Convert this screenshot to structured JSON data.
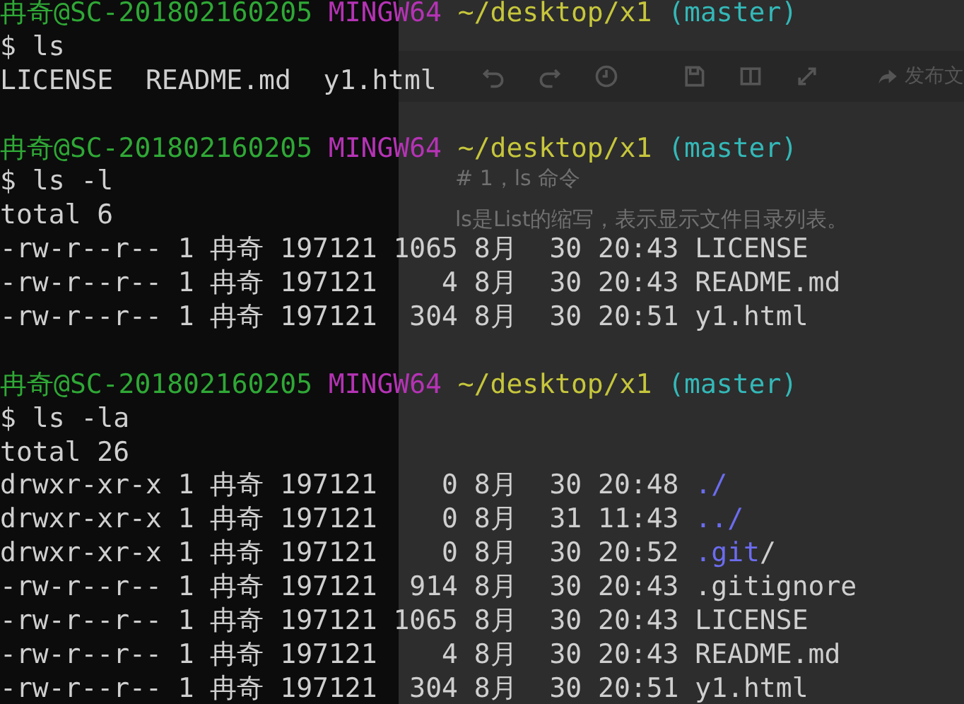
{
  "editor": {
    "toolbar": {
      "publish_label": "发布文"
    },
    "heading": "# 1，ls 命令",
    "paragraph": "ls是List的缩写，表示显示文件目录列表。"
  },
  "terminal": {
    "lines": [
      {
        "kind": "prompt",
        "segments": [
          {
            "kind": "user",
            "text": "冉奇@SC-201802160205"
          },
          {
            "kind": "env",
            "text": "MINGW64"
          },
          {
            "kind": "path",
            "text": "~/desktop/x1"
          },
          {
            "kind": "branch",
            "text": "(master)"
          }
        ]
      },
      {
        "kind": "command",
        "segments": [
          {
            "kind": "plain",
            "text": "$ ls"
          }
        ]
      },
      {
        "kind": "output",
        "segments": [
          {
            "kind": "plain",
            "text": "LICENSE  README.md  y1.html"
          }
        ]
      },
      {
        "kind": "blank"
      },
      {
        "kind": "prompt",
        "segments": [
          {
            "kind": "user",
            "text": "冉奇@SC-201802160205"
          },
          {
            "kind": "env",
            "text": "MINGW64"
          },
          {
            "kind": "path",
            "text": "~/desktop/x1"
          },
          {
            "kind": "branch",
            "text": "(master)"
          }
        ]
      },
      {
        "kind": "command",
        "segments": [
          {
            "kind": "plain",
            "text": "$ ls -l"
          }
        ]
      },
      {
        "kind": "output",
        "segments": [
          {
            "kind": "plain",
            "text": "total 6"
          }
        ]
      },
      {
        "kind": "output",
        "segments": [
          {
            "kind": "plain",
            "text": "-rw-r--r-- 1 冉奇 197121 1065 8月  30 20:43 LICENSE"
          }
        ]
      },
      {
        "kind": "output",
        "segments": [
          {
            "kind": "plain",
            "text": "-rw-r--r-- 1 冉奇 197121    4 8月  30 20:43 README.md"
          }
        ]
      },
      {
        "kind": "output",
        "segments": [
          {
            "kind": "plain",
            "text": "-rw-r--r-- 1 冉奇 197121  304 8月  30 20:51 y1.html"
          }
        ]
      },
      {
        "kind": "blank"
      },
      {
        "kind": "prompt",
        "segments": [
          {
            "kind": "user",
            "text": "冉奇@SC-201802160205"
          },
          {
            "kind": "env",
            "text": "MINGW64"
          },
          {
            "kind": "path",
            "text": "~/desktop/x1"
          },
          {
            "kind": "branch",
            "text": "(master)"
          }
        ]
      },
      {
        "kind": "command",
        "segments": [
          {
            "kind": "plain",
            "text": "$ ls -la"
          }
        ]
      },
      {
        "kind": "output",
        "segments": [
          {
            "kind": "plain",
            "text": "total 26"
          }
        ]
      },
      {
        "kind": "output",
        "segments": [
          {
            "kind": "plain",
            "text": "drwxr-xr-x 1 冉奇 197121    0 8月  30 20:48 "
          },
          {
            "kind": "dir",
            "text": "./"
          }
        ]
      },
      {
        "kind": "output",
        "segments": [
          {
            "kind": "plain",
            "text": "drwxr-xr-x 1 冉奇 197121    0 8月  31 11:43 "
          },
          {
            "kind": "dir",
            "text": "../"
          }
        ]
      },
      {
        "kind": "output",
        "segments": [
          {
            "kind": "plain",
            "text": "drwxr-xr-x 1 冉奇 197121    0 8月  30 20:52 "
          },
          {
            "kind": "dir",
            "text": ".git"
          },
          {
            "kind": "plain",
            "text": "/"
          }
        ]
      },
      {
        "kind": "output",
        "segments": [
          {
            "kind": "plain",
            "text": "-rw-r--r-- 1 冉奇 197121  914 8月  30 20:43 .gitignore"
          }
        ]
      },
      {
        "kind": "output",
        "segments": [
          {
            "kind": "plain",
            "text": "-rw-r--r-- 1 冉奇 197121 1065 8月  30 20:43 LICENSE"
          }
        ]
      },
      {
        "kind": "output",
        "segments": [
          {
            "kind": "plain",
            "text": "-rw-r--r-- 1 冉奇 197121    4 8月  30 20:43 README.md"
          }
        ]
      },
      {
        "kind": "output",
        "segments": [
          {
            "kind": "plain",
            "text": "-rw-r--r-- 1 冉奇 197121  304 8月  30 20:51 y1.html"
          }
        ]
      }
    ]
  }
}
